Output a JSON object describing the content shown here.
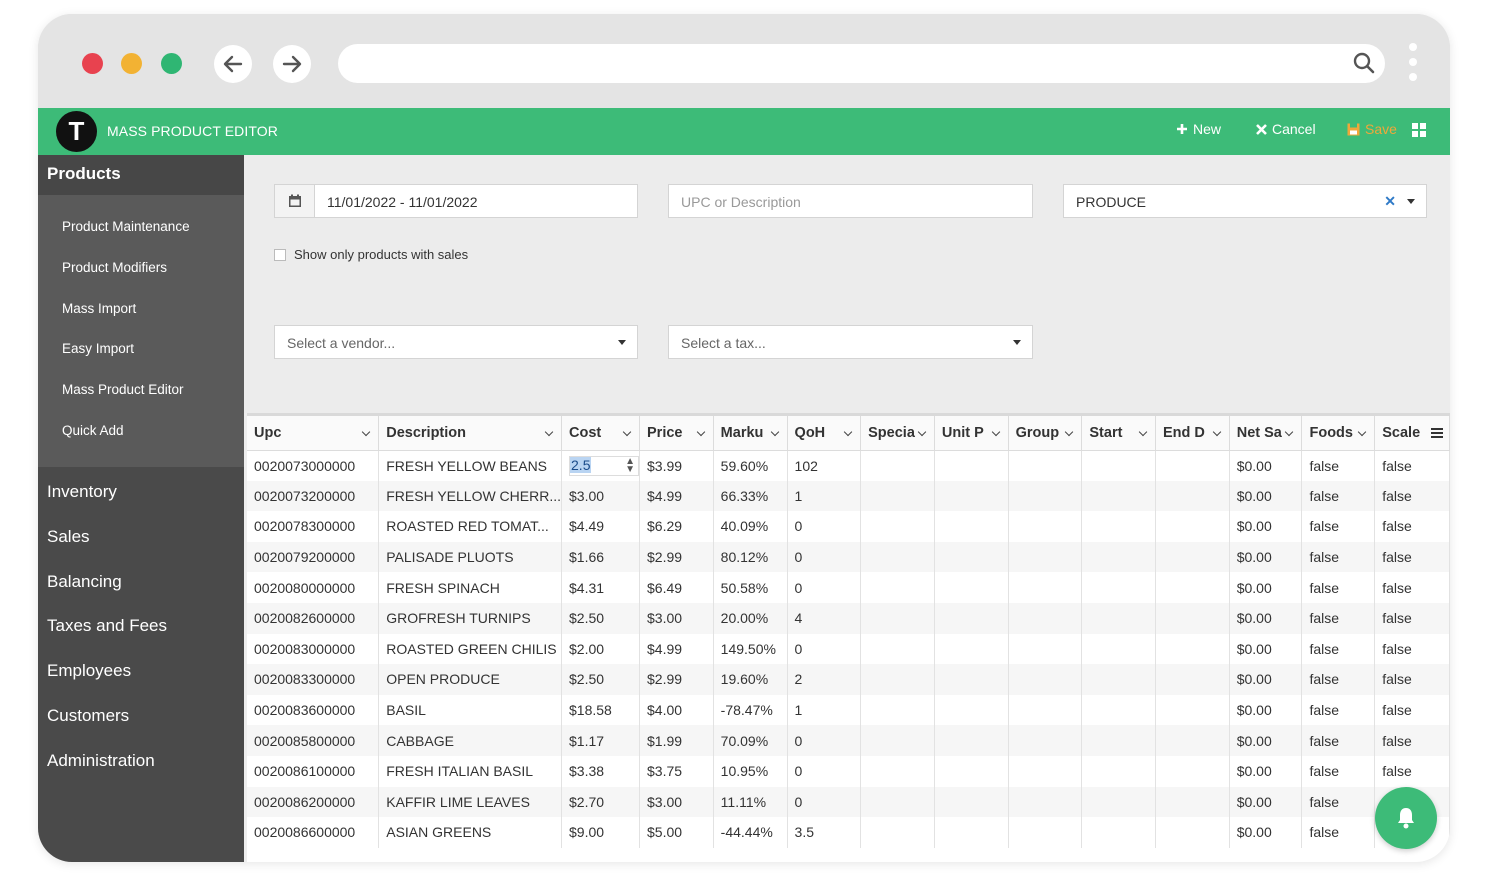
{
  "app": {
    "logo_letter": "T",
    "title": "MASS PRODUCT EDITOR",
    "actions": {
      "new": "New",
      "cancel": "Cancel",
      "save": "Save"
    }
  },
  "sidebar": {
    "section": "Products",
    "subitems": [
      "Product Maintenance",
      "Product Modifiers",
      "Mass Import",
      "Easy Import",
      "Mass Product Editor",
      "Quick Add"
    ],
    "items": [
      "Inventory",
      "Sales",
      "Balancing",
      "Taxes and Fees",
      "Employees",
      "Customers",
      "Administration"
    ]
  },
  "filters": {
    "date_range": "11/01/2022 - 11/01/2022",
    "upc_placeholder": "UPC or Description",
    "category": "PRODUCE",
    "show_sales_label": "Show only products with sales",
    "vendor_placeholder": "Select a vendor...",
    "tax_placeholder": "Select a tax..."
  },
  "table": {
    "columns": [
      "Upc",
      "Description",
      "Cost",
      "Price",
      "Marku",
      "QoH",
      "Specia",
      "Unit P",
      "Group",
      "Start",
      "End D",
      "Net Sa",
      "Foods",
      "Scale"
    ],
    "editing_cost": "2.5",
    "rows": [
      [
        "0020073000000",
        "FRESH YELLOW BEANS",
        "2.5",
        "$3.99",
        "59.60%",
        "102",
        "",
        "",
        "",
        "",
        "",
        "$0.00",
        "false",
        "false"
      ],
      [
        "0020073200000",
        "FRESH YELLOW CHERR...",
        "$3.00",
        "$4.99",
        "66.33%",
        "1",
        "",
        "",
        "",
        "",
        "",
        "$0.00",
        "false",
        "false"
      ],
      [
        "0020078300000",
        "ROASTED RED TOMAT...",
        "$4.49",
        "$6.29",
        "40.09%",
        "0",
        "",
        "",
        "",
        "",
        "",
        "$0.00",
        "false",
        "false"
      ],
      [
        "0020079200000",
        "PALISADE PLUOTS",
        "$1.66",
        "$2.99",
        "80.12%",
        "0",
        "",
        "",
        "",
        "",
        "",
        "$0.00",
        "false",
        "false"
      ],
      [
        "0020080000000",
        "FRESH SPINACH",
        "$4.31",
        "$6.49",
        "50.58%",
        "0",
        "",
        "",
        "",
        "",
        "",
        "$0.00",
        "false",
        "false"
      ],
      [
        "0020082600000",
        "GROFRESH TURNIPS",
        "$2.50",
        "$3.00",
        "20.00%",
        "4",
        "",
        "",
        "",
        "",
        "",
        "$0.00",
        "false",
        "false"
      ],
      [
        "0020083000000",
        "ROASTED GREEN CHILIS",
        "$2.00",
        "$4.99",
        "149.50%",
        "0",
        "",
        "",
        "",
        "",
        "",
        "$0.00",
        "false",
        "false"
      ],
      [
        "0020083300000",
        "OPEN PRODUCE",
        "$2.50",
        "$2.99",
        "19.60%",
        "2",
        "",
        "",
        "",
        "",
        "",
        "$0.00",
        "false",
        "false"
      ],
      [
        "0020083600000",
        "BASIL",
        "$18.58",
        "$4.00",
        "-78.47%",
        "1",
        "",
        "",
        "",
        "",
        "",
        "$0.00",
        "false",
        "false"
      ],
      [
        "0020085800000",
        "CABBAGE",
        "$1.17",
        "$1.99",
        "70.09%",
        "0",
        "",
        "",
        "",
        "",
        "",
        "$0.00",
        "false",
        "false"
      ],
      [
        "0020086100000",
        "FRESH ITALIAN BASIL",
        "$3.38",
        "$3.75",
        "10.95%",
        "0",
        "",
        "",
        "",
        "",
        "",
        "$0.00",
        "false",
        "false"
      ],
      [
        "0020086200000",
        "KAFFIR LIME LEAVES",
        "$2.70",
        "$3.00",
        "11.11%",
        "0",
        "",
        "",
        "",
        "",
        "",
        "$0.00",
        "false",
        "false"
      ],
      [
        "0020086600000",
        "ASIAN GREENS",
        "$9.00",
        "$5.00",
        "-44.44%",
        "3.5",
        "",
        "",
        "",
        "",
        "",
        "$0.00",
        "false",
        "false"
      ]
    ]
  }
}
